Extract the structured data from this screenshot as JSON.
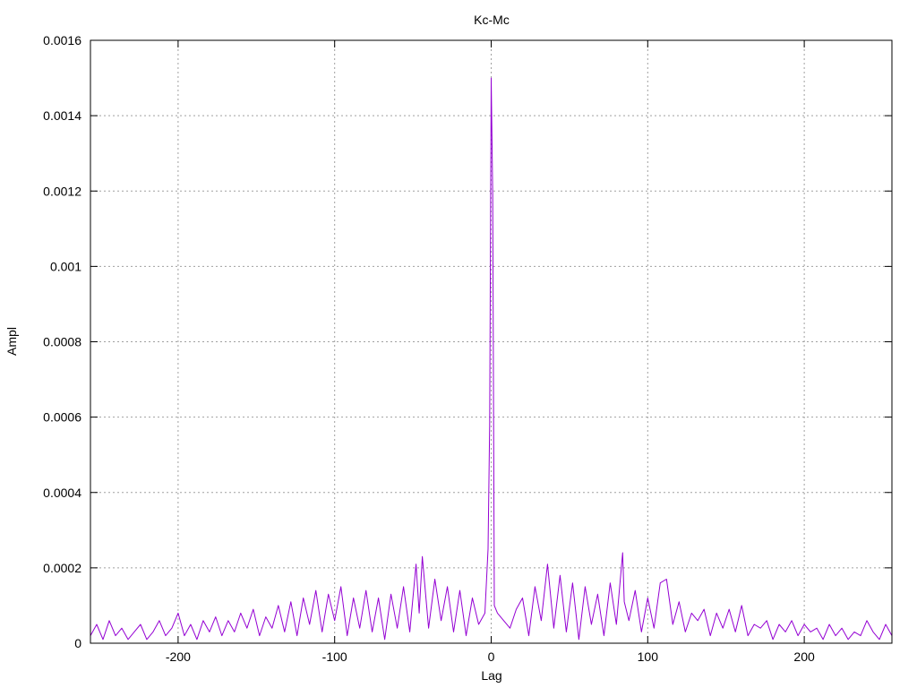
{
  "chart_data": {
    "type": "line",
    "title": "Kc-Mc",
    "xlabel": "Lag",
    "ylabel": "Ampl",
    "xlim": [
      -256,
      256
    ],
    "ylim": [
      0,
      0.0016
    ],
    "grid": true,
    "line_color": "#9400d3",
    "x_ticks": [
      -200,
      -100,
      0,
      100,
      200
    ],
    "x_tick_labels": [
      "-200",
      "-100",
      "0",
      "100",
      "200"
    ],
    "y_ticks": [
      0,
      0.0002,
      0.0004,
      0.0006,
      0.0008,
      0.001,
      0.0012,
      0.0014,
      0.0016
    ],
    "y_tick_labels": [
      "0",
      "0.0002",
      "0.0004",
      "0.0006",
      "0.0008",
      "0.001",
      "0.0012",
      "0.0014",
      "0.0016"
    ],
    "series": [
      {
        "x": [
          -256,
          -252,
          -248,
          -244,
          -240,
          -236,
          -232,
          -228,
          -224,
          -220,
          -216,
          -212,
          -208,
          -204,
          -200,
          -196,
          -192,
          -188,
          -184,
          -180,
          -176,
          -172,
          -168,
          -164,
          -160,
          -156,
          -152,
          -148,
          -144,
          -140,
          -136,
          -132,
          -128,
          -124,
          -120,
          -116,
          -112,
          -108,
          -104,
          -100,
          -96,
          -92,
          -88,
          -84,
          -80,
          -76,
          -72,
          -68,
          -64,
          -60,
          -56,
          -52,
          -48,
          -46,
          -44,
          -40,
          -36,
          -32,
          -28,
          -24,
          -20,
          -16,
          -12,
          -8,
          -4,
          -2,
          -1,
          0,
          1,
          2,
          4,
          8,
          12,
          16,
          20,
          24,
          28,
          32,
          36,
          40,
          44,
          48,
          52,
          56,
          60,
          64,
          68,
          72,
          76,
          80,
          84,
          85,
          88,
          92,
          96,
          100,
          104,
          108,
          112,
          116,
          120,
          124,
          128,
          132,
          136,
          140,
          144,
          148,
          152,
          156,
          160,
          164,
          168,
          172,
          176,
          180,
          184,
          188,
          192,
          196,
          200,
          204,
          208,
          212,
          216,
          220,
          224,
          228,
          232,
          236,
          240,
          244,
          248,
          252,
          256
        ],
        "y": [
          2e-05,
          5e-05,
          1e-05,
          6e-05,
          2e-05,
          4e-05,
          1e-05,
          3e-05,
          5e-05,
          1e-05,
          3e-05,
          6e-05,
          2e-05,
          4e-05,
          8e-05,
          2e-05,
          5e-05,
          1e-05,
          6e-05,
          3e-05,
          7e-05,
          2e-05,
          6e-05,
          3e-05,
          8e-05,
          4e-05,
          9e-05,
          2e-05,
          7e-05,
          4e-05,
          0.0001,
          3e-05,
          0.00011,
          2e-05,
          0.00012,
          5e-05,
          0.00014,
          3e-05,
          0.00013,
          6e-05,
          0.00015,
          2e-05,
          0.00012,
          4e-05,
          0.00014,
          3e-05,
          0.00012,
          1e-05,
          0.00013,
          4e-05,
          0.00015,
          3e-05,
          0.00021,
          8e-05,
          0.00023,
          4e-05,
          0.00017,
          6e-05,
          0.00015,
          3e-05,
          0.00014,
          2e-05,
          0.00012,
          5e-05,
          8e-05,
          0.00025,
          0.00058,
          0.0015,
          0.00119,
          0.0001,
          8e-05,
          6e-05,
          4e-05,
          9e-05,
          0.00012,
          2e-05,
          0.00015,
          6e-05,
          0.00021,
          4e-05,
          0.00018,
          3e-05,
          0.00016,
          1e-05,
          0.00015,
          5e-05,
          0.00013,
          2e-05,
          0.00016,
          5e-05,
          0.00024,
          0.00011,
          6e-05,
          0.00014,
          3e-05,
          0.00012,
          4e-05,
          0.00016,
          0.00017,
          5e-05,
          0.00011,
          3e-05,
          8e-05,
          6e-05,
          9e-05,
          2e-05,
          8e-05,
          4e-05,
          9e-05,
          3e-05,
          0.0001,
          2e-05,
          5e-05,
          4e-05,
          6e-05,
          1e-05,
          5e-05,
          3e-05,
          6e-05,
          2e-05,
          5e-05,
          3e-05,
          4e-05,
          1e-05,
          5e-05,
          2e-05,
          4e-05,
          1e-05,
          3e-05,
          2e-05,
          6e-05,
          3e-05,
          1e-05,
          5e-05,
          2e-05
        ]
      }
    ]
  }
}
